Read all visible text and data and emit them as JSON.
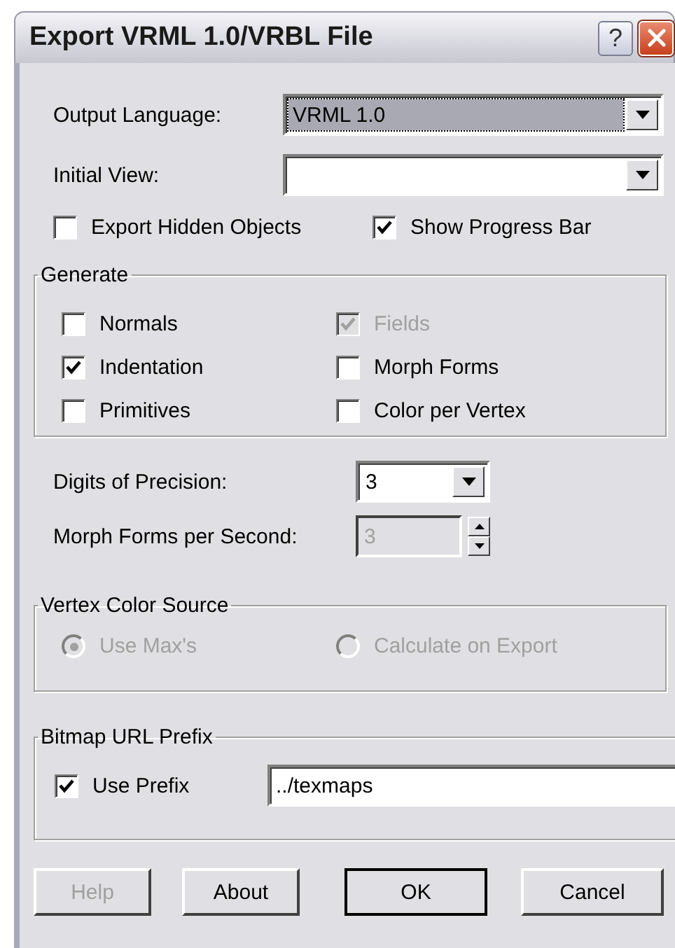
{
  "window": {
    "title": "Export VRML 1.0/VRBL File"
  },
  "title_buttons": [
    {
      "kind": "help",
      "label": "?"
    },
    {
      "kind": "close"
    }
  ],
  "dropdowns": [
    {
      "label": "Output Language:",
      "value": "VRML 1.0",
      "focused": true
    },
    {
      "label": "Initial View:",
      "focused": false
    }
  ],
  "options": [
    {
      "label": "Export Hidden Objects",
      "checked": false
    },
    {
      "label": "Show Progress Bar",
      "checked": true
    }
  ],
  "generate": {
    "title": "Generate",
    "items": [
      {
        "label": "Normals",
        "checked": false,
        "disabled": false
      },
      {
        "label": "Fields",
        "checked": true,
        "disabled": true
      },
      {
        "label": "Indentation",
        "checked": true,
        "disabled": false
      },
      {
        "label": "Morph Forms",
        "checked": false,
        "disabled": false
      },
      {
        "label": "Primitives",
        "checked": false,
        "disabled": false
      },
      {
        "label": "Color per Vertex",
        "checked": false,
        "disabled": false
      }
    ]
  },
  "precision": {
    "label": "Digits of Precision:",
    "value": "3"
  },
  "morph_rate": {
    "label": "Morph Forms per Second:",
    "value": "3",
    "disabled": true
  },
  "vertex_color_source": {
    "title": "Vertex Color Source",
    "options": [
      {
        "label": "Use Max's",
        "selected": true,
        "disabled": true
      },
      {
        "label": "Calculate on Export",
        "selected": false,
        "disabled": true
      }
    ]
  },
  "bitmap_url_prefix": {
    "title": "Bitmap URL Prefix",
    "use_prefix": {
      "label": "Use Prefix",
      "checked": true
    },
    "value": "../texmaps"
  },
  "buttons": [
    {
      "label": "Help",
      "disabled": true,
      "default": false
    },
    {
      "label": "About",
      "disabled": false,
      "default": false
    },
    {
      "label": "OK",
      "disabled": false,
      "default": true
    },
    {
      "label": "Cancel",
      "disabled": false,
      "default": false
    }
  ]
}
